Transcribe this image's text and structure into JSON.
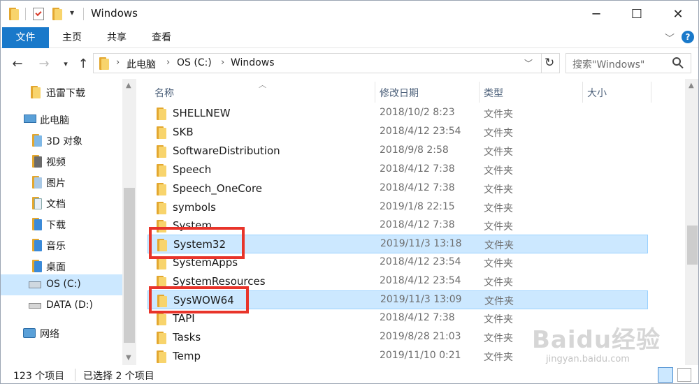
{
  "window": {
    "title": "Windows"
  },
  "ribbon": {
    "tabs": [
      "文件",
      "主页",
      "共享",
      "查看"
    ]
  },
  "address": {
    "crumbs": [
      "此电脑",
      "OS (C:)",
      "Windows"
    ],
    "search_placeholder": "搜索\"Windows\""
  },
  "nav": {
    "items": [
      {
        "label": "迅雷下载",
        "icon": "folder-icon"
      },
      {
        "label": "此电脑",
        "icon": "computer-icon"
      },
      {
        "label": "3D 对象",
        "icon": "3d-objects-icon"
      },
      {
        "label": "视频",
        "icon": "video-folder-icon"
      },
      {
        "label": "图片",
        "icon": "pictures-folder-icon"
      },
      {
        "label": "文档",
        "icon": "documents-folder-icon"
      },
      {
        "label": "下载",
        "icon": "downloads-folder-icon"
      },
      {
        "label": "音乐",
        "icon": "music-folder-icon"
      },
      {
        "label": "桌面",
        "icon": "desktop-folder-icon"
      },
      {
        "label": "OS (C:)",
        "icon": "system-drive-icon"
      },
      {
        "label": "DATA (D:)",
        "icon": "drive-icon"
      },
      {
        "label": "网络",
        "icon": "network-icon"
      }
    ]
  },
  "columns": {
    "name": "名称",
    "modified": "修改日期",
    "type": "类型",
    "size": "大小"
  },
  "files": [
    {
      "name": "SHELLNEW",
      "modified": "2018/10/2 8:23",
      "type": "文件夹"
    },
    {
      "name": "SKB",
      "modified": "2018/4/12 23:54",
      "type": "文件夹"
    },
    {
      "name": "SoftwareDistribution",
      "modified": "2018/9/8 2:58",
      "type": "文件夹"
    },
    {
      "name": "Speech",
      "modified": "2018/4/12 7:38",
      "type": "文件夹"
    },
    {
      "name": "Speech_OneCore",
      "modified": "2018/4/12 7:38",
      "type": "文件夹"
    },
    {
      "name": "symbols",
      "modified": "2019/1/8 22:15",
      "type": "文件夹"
    },
    {
      "name": "System",
      "modified": "2018/4/12 7:38",
      "type": "文件夹"
    },
    {
      "name": "System32",
      "modified": "2019/11/3 13:18",
      "type": "文件夹",
      "selected": true
    },
    {
      "name": "SystemApps",
      "modified": "2018/4/12 23:54",
      "type": "文件夹"
    },
    {
      "name": "SystemResources",
      "modified": "2018/4/12 23:54",
      "type": "文件夹"
    },
    {
      "name": "SysWOW64",
      "modified": "2019/11/3 13:09",
      "type": "文件夹",
      "selected": true
    },
    {
      "name": "TAPI",
      "modified": "2018/4/12 7:38",
      "type": "文件夹"
    },
    {
      "name": "Tasks",
      "modified": "2019/8/28 21:03",
      "type": "文件夹"
    },
    {
      "name": "Temp",
      "modified": "2019/11/10 0:21",
      "type": "文件夹"
    }
  ],
  "status": {
    "count": "123 个项目",
    "selected": "已选择 2 个项目"
  },
  "watermark": {
    "logo": "Baidu经验",
    "url": "jingyan.baidu.com"
  },
  "colors": {
    "accent": "#1979ca",
    "selection": "#cce8ff",
    "highlight": "#e8342a"
  }
}
